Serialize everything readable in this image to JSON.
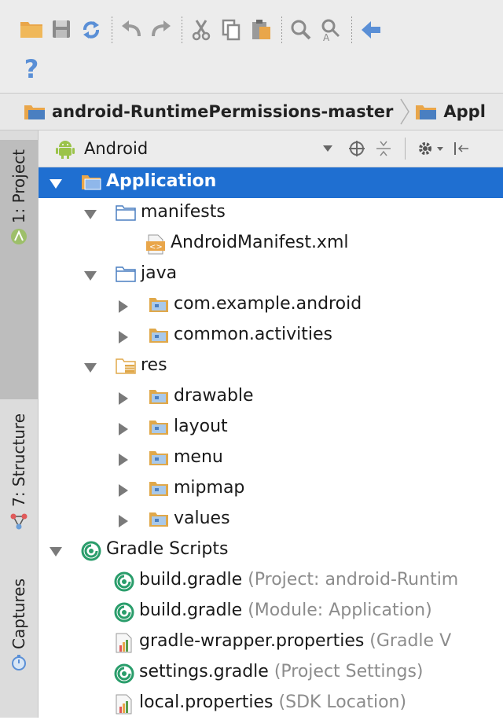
{
  "toolbar": {
    "row1": [
      {
        "icon": "open-folder-icon"
      },
      {
        "icon": "save-icon"
      },
      {
        "icon": "sync-icon"
      },
      {
        "sep": true
      },
      {
        "icon": "undo-icon"
      },
      {
        "icon": "redo-icon"
      },
      {
        "sep": true
      },
      {
        "icon": "cut-icon"
      },
      {
        "icon": "copy-icon"
      },
      {
        "icon": "paste-icon"
      },
      {
        "sep": true
      },
      {
        "icon": "find-icon"
      },
      {
        "icon": "replace-icon"
      },
      {
        "sep": true
      },
      {
        "icon": "back-icon"
      }
    ],
    "help_label": "?"
  },
  "breadcrumb": {
    "items": [
      "android-RuntimePermissions-master",
      "Appl"
    ]
  },
  "tool_stripe": {
    "project_tab": "1: Project",
    "structure_tab": "7: Structure",
    "captures_tab": "Captures"
  },
  "view_header": {
    "view_label": "Android"
  },
  "tree": [
    {
      "label": "Application",
      "hint": "",
      "depth": 0,
      "expander": "down",
      "icon": "module-folder",
      "bold": true,
      "selected": true
    },
    {
      "label": "manifests",
      "hint": "",
      "depth": 1,
      "expander": "down",
      "icon": "folder",
      "bold": false
    },
    {
      "label": "AndroidManifest.xml",
      "hint": "",
      "depth": 2,
      "expander": "none",
      "icon": "xml-file",
      "bold": false
    },
    {
      "label": "java",
      "hint": "",
      "depth": 1,
      "expander": "down",
      "icon": "folder",
      "bold": false
    },
    {
      "label": "com.example.android",
      "hint": "",
      "depth": 2,
      "expander": "right",
      "icon": "package",
      "bold": false
    },
    {
      "label": "common.activities",
      "hint": "",
      "depth": 2,
      "expander": "right",
      "icon": "package",
      "bold": false
    },
    {
      "label": "res",
      "hint": "",
      "depth": 1,
      "expander": "down",
      "icon": "res-folder",
      "bold": false
    },
    {
      "label": "drawable",
      "hint": "",
      "depth": 2,
      "expander": "right",
      "icon": "package",
      "bold": false
    },
    {
      "label": "layout",
      "hint": "",
      "depth": 2,
      "expander": "right",
      "icon": "package",
      "bold": false
    },
    {
      "label": "menu",
      "hint": "",
      "depth": 2,
      "expander": "right",
      "icon": "package",
      "bold": false
    },
    {
      "label": "mipmap",
      "hint": "",
      "depth": 2,
      "expander": "right",
      "icon": "package",
      "bold": false
    },
    {
      "label": "values",
      "hint": "",
      "depth": 2,
      "expander": "right",
      "icon": "package",
      "bold": false
    },
    {
      "label": "Gradle Scripts",
      "hint": "",
      "depth": 0,
      "expander": "down",
      "icon": "gradle",
      "bold": false
    },
    {
      "label": "build.gradle",
      "hint": " (Project: android-Runtim",
      "depth": 1,
      "expander": "none",
      "icon": "gradle",
      "bold": false
    },
    {
      "label": "build.gradle",
      "hint": " (Module: Application)",
      "depth": 1,
      "expander": "none",
      "icon": "gradle",
      "bold": false
    },
    {
      "label": "gradle-wrapper.properties",
      "hint": " (Gradle V",
      "depth": 1,
      "expander": "none",
      "icon": "properties-file",
      "bold": false
    },
    {
      "label": "settings.gradle",
      "hint": " (Project Settings)",
      "depth": 1,
      "expander": "none",
      "icon": "gradle",
      "bold": false
    },
    {
      "label": "local.properties",
      "hint": " (SDK Location)",
      "depth": 1,
      "expander": "none",
      "icon": "properties-file",
      "bold": false
    }
  ],
  "colors": {
    "selection": "#1f6fd1",
    "folder_blue": "#4a7fc1",
    "package_orange": "#e0a84a",
    "gradle_green": "#2a9d6b"
  }
}
